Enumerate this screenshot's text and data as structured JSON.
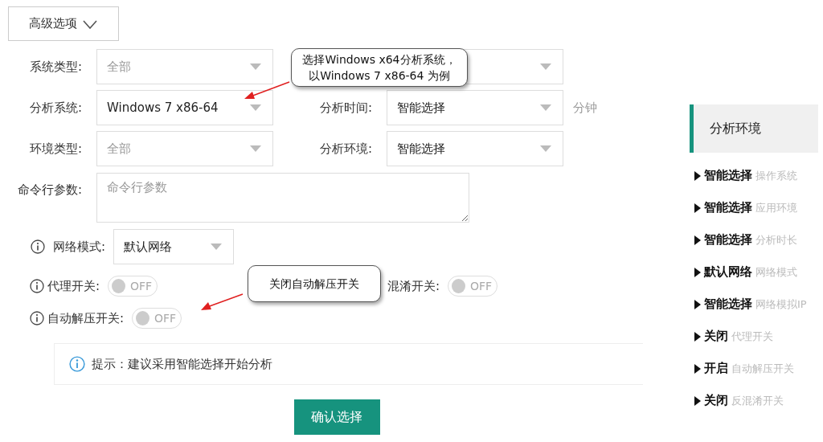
{
  "advanced_button": {
    "label": "高级选项",
    "expanded": false
  },
  "select_rows": [
    {
      "left": {
        "label": "系统类型:",
        "placeholder": "全部"
      },
      "right": {}
    },
    {
      "left": {
        "label": "分析系统:",
        "value": "Windows 7 x86-64"
      },
      "right": {
        "label": "分析时间:",
        "value": "智能选择",
        "unit": "分钟"
      }
    },
    {
      "left": {
        "label": "环境类型:",
        "placeholder": "全部"
      },
      "right": {
        "label": "分析环境:",
        "value": "智能选择"
      }
    }
  ],
  "command_line": {
    "label": "命令行参数:",
    "placeholder": "命令行参数"
  },
  "network_mode": {
    "label": "网络模式:",
    "value": "默认网络"
  },
  "switches": [
    {
      "label": "代理开关:",
      "on": false,
      "text": "OFF"
    },
    {
      "label": "混淆开关:",
      "on": false,
      "text": "OFF"
    },
    {
      "label": "自动解压开关:",
      "on": false,
      "text": "OFF"
    }
  ],
  "tip": "提示：建议采用智能选择开始分析",
  "confirm_button": "确认选择",
  "callouts": [
    {
      "text_lines": [
        "选择Windows x64分析系统，",
        "以Windows 7 x86-64 为例"
      ]
    },
    {
      "text_lines": [
        "关闭自动解压开关"
      ]
    }
  ],
  "sidebar": {
    "title": "分析环境",
    "items": [
      {
        "value": "智能选择",
        "label": "操作系统"
      },
      {
        "value": "智能选择",
        "label": "应用环境"
      },
      {
        "value": "智能选择",
        "label": "分析时长"
      },
      {
        "value": "默认网络",
        "label": "网络模式"
      },
      {
        "value": "智能选择",
        "label": "网络模拟IP"
      },
      {
        "value": "关闭",
        "label": "代理开关"
      },
      {
        "value": "开启",
        "label": "自动解压开关"
      },
      {
        "value": "关闭",
        "label": "反混淆开关"
      }
    ]
  }
}
